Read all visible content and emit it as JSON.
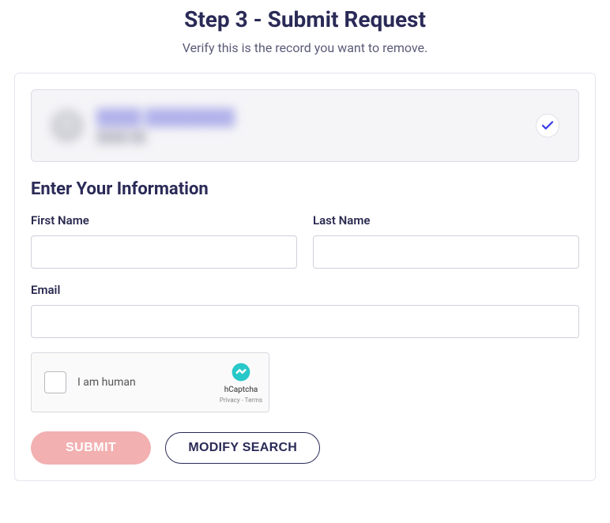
{
  "header": {
    "title": "Step 3 - Submit Request",
    "subtitle": "Verify this is the record you want to remove."
  },
  "record": {
    "name_line": "████ ████████",
    "sub_line": "████ ██"
  },
  "form": {
    "section_heading": "Enter Your Information",
    "first_name": {
      "label": "First Name",
      "value": ""
    },
    "last_name": {
      "label": "Last Name",
      "value": ""
    },
    "email": {
      "label": "Email",
      "value": ""
    }
  },
  "captcha": {
    "text": "I am human",
    "brand": "hCaptcha",
    "links": "Privacy - Terms"
  },
  "buttons": {
    "submit": "SUBMIT",
    "modify": "MODIFY SEARCH"
  }
}
